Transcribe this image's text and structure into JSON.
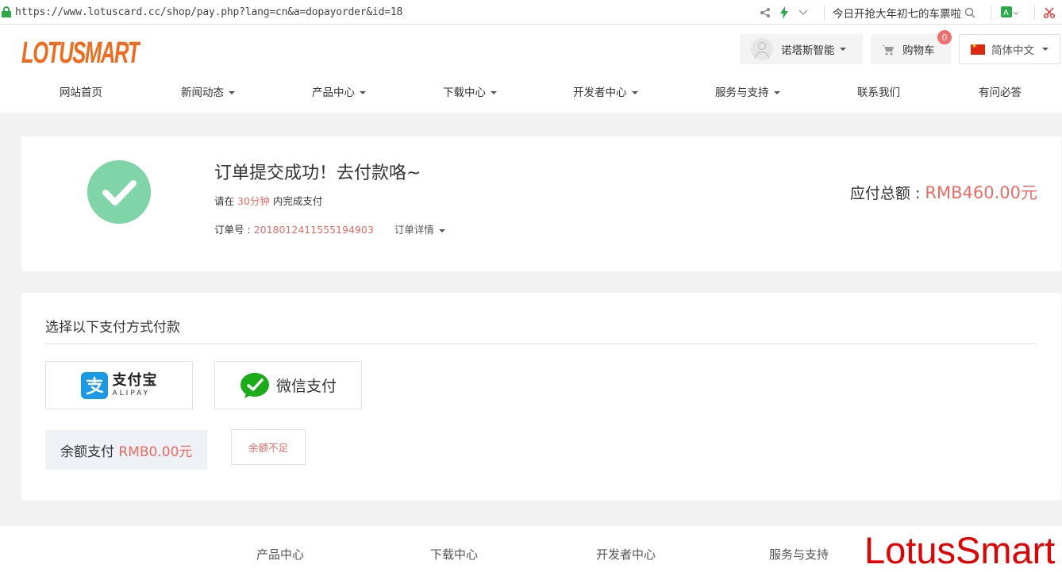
{
  "browser": {
    "url": "https://www.lotuscard.cc/shop/pay.php?lang=cn&a=dopayorder&id=18",
    "search_text": "今日开抢大年初七的车票啦"
  },
  "header": {
    "logo_text": "LOTUSMART",
    "user_name": "诺塔斯智能",
    "cart_label": "购物车",
    "cart_count": "0",
    "language": "简体中文"
  },
  "nav": {
    "items": [
      {
        "label": "网站首页",
        "dropdown": false
      },
      {
        "label": "新闻动态",
        "dropdown": true
      },
      {
        "label": "产品中心",
        "dropdown": true
      },
      {
        "label": "下载中心",
        "dropdown": true
      },
      {
        "label": "开发者中心",
        "dropdown": true
      },
      {
        "label": "服务与支持",
        "dropdown": true
      },
      {
        "label": "联系我们",
        "dropdown": false
      },
      {
        "label": "有问必答",
        "dropdown": false
      }
    ]
  },
  "order": {
    "title": "订单提交成功！去付款咯~",
    "note_prefix": "请在",
    "note_time": "30分钟",
    "note_suffix": "内完成支付",
    "order_no_label": "订单号 : ",
    "order_no": "2018012411555194903",
    "detail_label": "订单详情",
    "amount_label": "应付总额 : ",
    "amount_value": "RMB460.00元"
  },
  "payment": {
    "title": "选择以下支付方式付款",
    "alipay_cn": "支付宝",
    "alipay_en": "ALIPAY",
    "wechat_label": "微信支付",
    "balance_label": "余额支付 ",
    "balance_value": "RMB0.00元",
    "insufficient_label": "余额不足"
  },
  "footer": {
    "items": [
      "产品中心",
      "下载中心",
      "开发者中心",
      "服务与支持"
    ]
  },
  "watermark": "LotusSmart",
  "colors": {
    "accent_red": "#ec6b64",
    "success_green": "#7fd4a8",
    "logo_orange": "#f26b1d",
    "alipay_blue": "#1a9ae6",
    "wechat_green": "#1aad19"
  }
}
